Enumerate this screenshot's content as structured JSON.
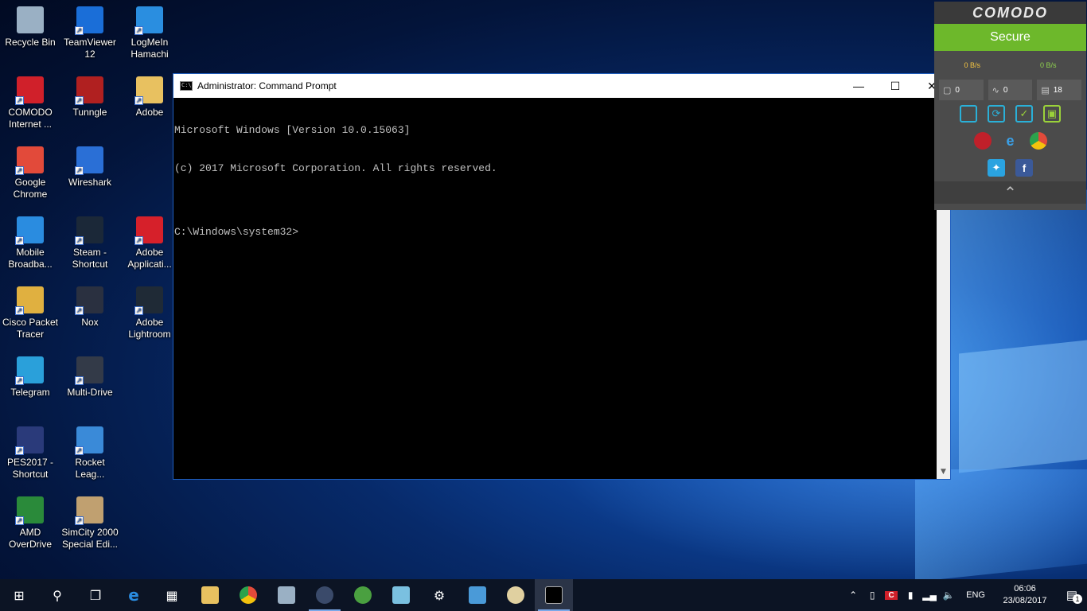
{
  "desktop": {
    "icons": [
      {
        "label": "Recycle Bin",
        "icon": "recycle-bin-icon",
        "color": "#9ab0c4"
      },
      {
        "label": "TeamViewer 12",
        "icon": "teamviewer-icon",
        "color": "#1a6ed8"
      },
      {
        "label": "LogMeIn Hamachi",
        "icon": "hamachi-icon",
        "color": "#2a8ee0"
      },
      {
        "label": "COMODO Internet ...",
        "icon": "comodo-icon",
        "color": "#d0202a"
      },
      {
        "label": "Tunngle",
        "icon": "tunngle-icon",
        "color": "#b02020"
      },
      {
        "label": "Adobe",
        "icon": "folder-icon",
        "color": "#e8c160"
      },
      {
        "label": "Google Chrome",
        "icon": "chrome-icon",
        "color": "#e24a3a"
      },
      {
        "label": "Wireshark",
        "icon": "wireshark-icon",
        "color": "#2a6fd6"
      },
      {
        "label": "Mobile Broadba...",
        "icon": "mobile-broadband-icon",
        "color": "#2a8ce0"
      },
      {
        "label": "Steam - Shortcut",
        "icon": "steam-icon",
        "color": "#1b2838"
      },
      {
        "label": "Adobe Applicati...",
        "icon": "adobe-icon",
        "color": "#d6202a"
      },
      {
        "label": "Cisco Packet Tracer",
        "icon": "packet-tracer-icon",
        "color": "#e0b040"
      },
      {
        "label": "Nox",
        "icon": "nox-icon",
        "color": "#2a3040"
      },
      {
        "label": "Adobe Lightroom",
        "icon": "lightroom-icon",
        "color": "#1f2a36"
      },
      {
        "label": "Telegram",
        "icon": "telegram-icon",
        "color": "#2aa0da"
      },
      {
        "label": "Multi-Drive",
        "icon": "multi-drive-icon",
        "color": "#333a48"
      },
      {
        "label": "PES2017 - Shortcut",
        "icon": "pes-icon",
        "color": "#2a3a7a"
      },
      {
        "label": "Rocket Leag...",
        "icon": "rocket-league-icon",
        "color": "#3a8ad8"
      },
      {
        "label": "AMD OverDrive",
        "icon": "amd-icon",
        "color": "#2a8a3a"
      },
      {
        "label": "SimCity 2000 Special Edi...",
        "icon": "simcity-icon",
        "color": "#c0a070"
      }
    ]
  },
  "cmd": {
    "title": "Administrator: Command Prompt",
    "lines": [
      "Microsoft Windows [Version 10.0.15063]",
      "(c) 2017 Microsoft Corporation. All rights reserved.",
      "",
      "C:\\Windows\\system32>"
    ]
  },
  "comodo": {
    "brand": "COMODO",
    "status": "Secure",
    "download_speed": "0 B/s",
    "upload_speed": "0 B/s",
    "counter1": "0",
    "counter2": "0",
    "counter3": "18"
  },
  "taskbar": {
    "language": "ENG",
    "time": "06:06",
    "date": "23/08/2017",
    "notification_count": "1"
  }
}
